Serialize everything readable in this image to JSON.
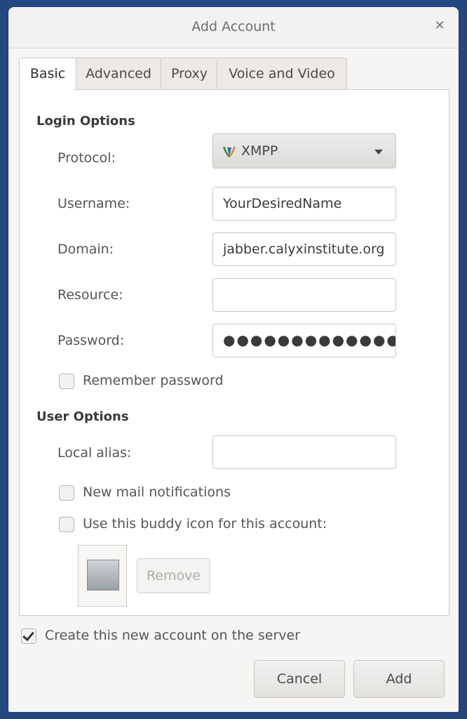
{
  "window": {
    "title": "Add Account"
  },
  "tabs": [
    {
      "label": "Basic"
    },
    {
      "label": "Advanced"
    },
    {
      "label": "Proxy"
    },
    {
      "label": "Voice and Video"
    }
  ],
  "login_options": {
    "heading": "Login Options",
    "protocol": {
      "label": "Protocol:",
      "value": "XMPP",
      "icon": "xmpp-protocol-icon"
    },
    "username": {
      "label": "Username:",
      "value": "YourDesiredName"
    },
    "domain": {
      "label": "Domain:",
      "value": "jabber.calyxinstitute.org"
    },
    "resource": {
      "label": "Resource:",
      "value": ""
    },
    "password": {
      "label": "Password:",
      "value": "●●●●●●●●●●●●●"
    },
    "remember_password": {
      "label": "Remember password",
      "checked": false
    }
  },
  "user_options": {
    "heading": "User Options",
    "local_alias": {
      "label": "Local alias:",
      "value": ""
    },
    "new_mail": {
      "label": "New mail notifications",
      "checked": false
    },
    "buddy_icon": {
      "label": "Use this buddy icon for this account:",
      "checked": false
    },
    "remove_label": "Remove"
  },
  "create_on_server": {
    "label": "Create this new account on the server",
    "checked": true
  },
  "buttons": {
    "cancel": "Cancel",
    "add": "Add"
  }
}
